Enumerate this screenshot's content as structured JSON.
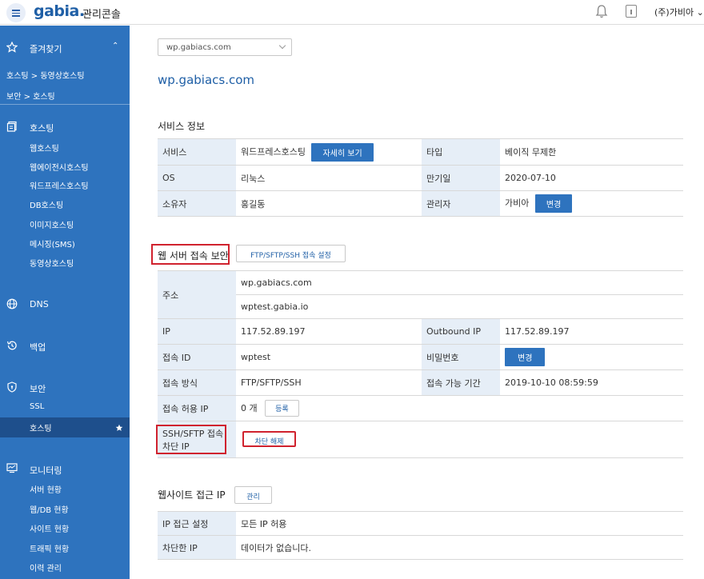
{
  "header": {
    "logo": "gabia.",
    "subtitle": "관리콘솔",
    "user_name": "(주)가비아"
  },
  "sidebar": {
    "favorites": {
      "label": "즐겨찾기",
      "items": [
        "호스팅 > 동영상호스팅",
        "보안 > 호스팅"
      ]
    },
    "hosting": {
      "label": "호스팅",
      "items": [
        "웹호스팅",
        "웹에이전시호스팅",
        "워드프레스호스팅",
        "DB호스팅",
        "이미지호스팅",
        "메시징(SMS)",
        "동영상호스팅"
      ]
    },
    "dns": {
      "label": "DNS"
    },
    "backup": {
      "label": "백업"
    },
    "security": {
      "label": "보안",
      "items": [
        "SSL",
        "호스팅"
      ]
    },
    "monitoring": {
      "label": "모니터링",
      "items": [
        "서버 현황",
        "웹/DB 현황",
        "사이트 현황",
        "트래픽 현황",
        "이력 관리"
      ]
    }
  },
  "main": {
    "domain_select": "wp.gabiacs.com",
    "domain_title": "wp.gabiacs.com",
    "service_info": {
      "title": "서비스 정보",
      "service_label": "서비스",
      "service_value": "워드프레스호스팅",
      "detail_button": "자세히 보기",
      "type_label": "타입",
      "type_value": "베이직 무제한",
      "os_label": "OS",
      "os_value": "리눅스",
      "expiry_label": "만기일",
      "expiry_value": "2020-07-10",
      "owner_label": "소유자",
      "owner_value": "홍길동",
      "admin_label": "관리자",
      "admin_value": "가비아",
      "admin_change": "변경"
    },
    "web_security": {
      "title": "웹 서버 접속 보안",
      "settings_button": "FTP/SFTP/SSH 접속 설정",
      "address_label": "주소",
      "address_1": "wp.gabiacs.com",
      "address_2": "wptest.gabia.io",
      "ip_label": "IP",
      "ip_value": "117.52.89.197",
      "outbound_label": "Outbound IP",
      "outbound_value": "117.52.89.197",
      "id_label": "접속 ID",
      "id_value": "wptest",
      "pw_label": "비밀번호",
      "pw_change": "변경",
      "method_label": "접속 방식",
      "method_value": "FTP/SFTP/SSH",
      "period_label": "접속 가능 기간",
      "period_value": "2019-10-10 08:59:59",
      "allowed_ip_label": "접속 허용 IP",
      "allowed_ip_value": "0 개",
      "register_button": "등록",
      "blocked_label_1": "SSH/SFTP 접속",
      "blocked_label_2": "차단 IP",
      "unblock_button": "차단 해제"
    },
    "site_access": {
      "title": "웹사이트 접근 IP",
      "manage_button": "관리",
      "setting_label": "IP 접근 설정",
      "setting_value": "모든 IP 허용",
      "blocked_label": "차단한 IP",
      "blocked_value": "데이터가 없습니다."
    }
  }
}
